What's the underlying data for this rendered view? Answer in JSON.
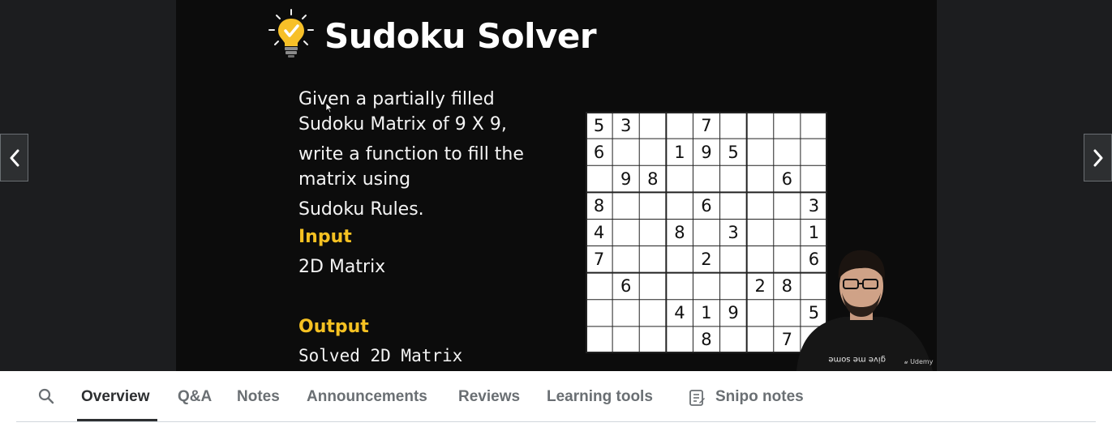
{
  "slide": {
    "title": "Sudoku Solver",
    "description_lines": [
      "Given a partially filled",
      "Sudoku Matrix of 9 X 9,",
      "write a function to fill the",
      "matrix using",
      "Sudoku Rules."
    ],
    "input_label": "Input",
    "input_value": "2D Matrix",
    "output_label": "Output",
    "output_value": "Solved 2D Matrix",
    "grid": [
      [
        "5",
        "3",
        "",
        "",
        "7",
        "",
        "",
        "",
        ""
      ],
      [
        "6",
        "",
        "",
        "1",
        "9",
        "5",
        "",
        "",
        ""
      ],
      [
        "",
        "9",
        "8",
        "",
        "",
        "",
        "",
        "6",
        ""
      ],
      [
        "8",
        "",
        "",
        "",
        "6",
        "",
        "",
        "",
        "3"
      ],
      [
        "4",
        "",
        "",
        "8",
        "",
        "3",
        "",
        "",
        "1"
      ],
      [
        "7",
        "",
        "",
        "",
        "2",
        "",
        "",
        "",
        "6"
      ],
      [
        "",
        "6",
        "",
        "",
        "",
        "",
        "2",
        "8",
        ""
      ],
      [
        "",
        "",
        "",
        "4",
        "1",
        "9",
        "",
        "",
        "5"
      ],
      [
        "",
        "",
        "",
        "",
        "8",
        "",
        "",
        "7",
        ""
      ]
    ],
    "watermark": "Udemy",
    "shirt_text": "give me some"
  },
  "player": {
    "prev_icon": "chevron-left-icon",
    "next_icon": "chevron-right-icon"
  },
  "tabs": [
    {
      "label": "Overview",
      "active": true
    },
    {
      "label": "Q&A"
    },
    {
      "label": "Notes"
    },
    {
      "label": "Announcements"
    },
    {
      "label": "Reviews"
    },
    {
      "label": "Learning tools"
    },
    {
      "label": "Snipo notes",
      "icon": "notes-icon"
    }
  ],
  "search_icon": "search-icon",
  "colors": {
    "accent_yellow": "#f5c122",
    "slide_bg": "#0c0c0c",
    "player_bg": "#1c1d1f",
    "tab_active": "#2d2f31",
    "tab_inactive": "#6a6f73"
  }
}
